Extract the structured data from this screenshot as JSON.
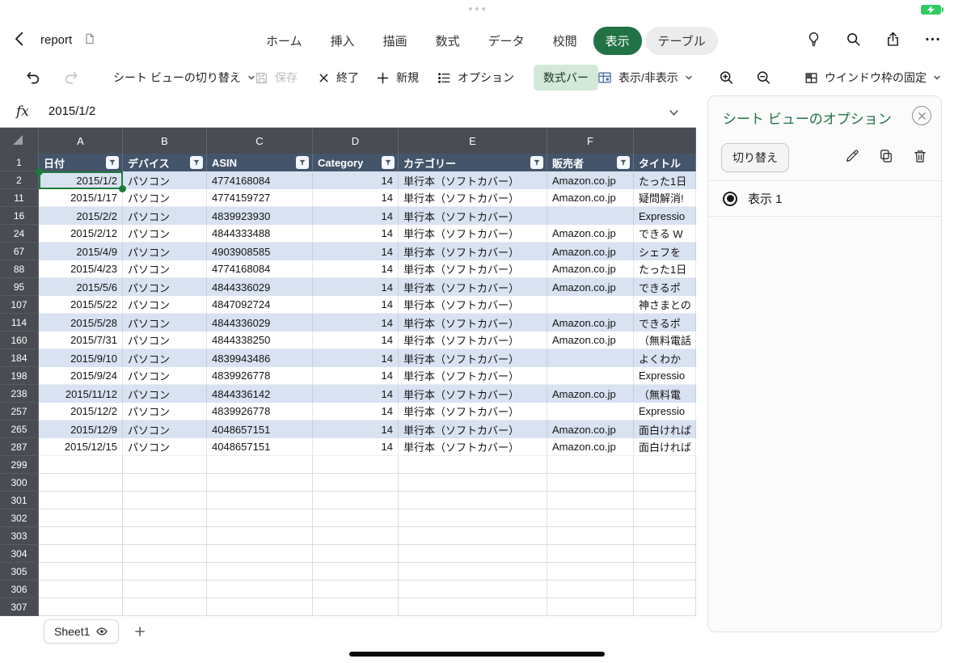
{
  "titlebar": {
    "doc_title": "report",
    "tabs": [
      {
        "label": "ホーム"
      },
      {
        "label": "挿入"
      },
      {
        "label": "描画"
      },
      {
        "label": "数式"
      },
      {
        "label": "データ"
      },
      {
        "label": "校閲"
      },
      {
        "label": "表示",
        "selected": true
      },
      {
        "label": "テーブル",
        "contextual": true
      }
    ]
  },
  "toolbar": {
    "sheet_view_switch": "シート ビューの切り替え",
    "save": "保存",
    "exit": "終了",
    "new": "新規",
    "options": "オプション",
    "formula_bar_toggle": "数式バー",
    "show_hide": "表示/非表示",
    "freeze": "ウインドウ枠の固定"
  },
  "formula_bar": {
    "fx": "fx",
    "value": "2015/1/2"
  },
  "grid": {
    "columns": [
      {
        "letter": "A",
        "width": 104,
        "align": "right"
      },
      {
        "letter": "B",
        "width": 104,
        "align": "left"
      },
      {
        "letter": "C",
        "width": 131,
        "align": "left"
      },
      {
        "letter": "D",
        "width": 106,
        "align": "right"
      },
      {
        "letter": "E",
        "width": 184,
        "align": "left"
      },
      {
        "letter": "F",
        "width": 107,
        "align": "left"
      },
      {
        "letter": "",
        "width": 77,
        "align": "left"
      }
    ],
    "header_row_num": "1",
    "headers": [
      {
        "label": "日付",
        "filter": true
      },
      {
        "label": "デバイス",
        "filter": true
      },
      {
        "label": "ASIN",
        "filter": true
      },
      {
        "label": "Category",
        "filter": true
      },
      {
        "label": "カテゴリー",
        "filter": true
      },
      {
        "label": "販売者",
        "filter": true
      },
      {
        "label": "タイトル",
        "filter": false
      }
    ],
    "rows": [
      {
        "num": 2,
        "band": true,
        "cells": [
          "2015/1/2",
          "パソコン",
          "4774168084",
          "14",
          "単行本（ソフトカバー）",
          "Amazon.co.jp",
          "たった1日"
        ]
      },
      {
        "num": 11,
        "band": false,
        "cells": [
          "2015/1/17",
          "パソコン",
          "4774159727",
          "14",
          "単行本（ソフトカバー）",
          "Amazon.co.jp",
          "疑問解消!"
        ]
      },
      {
        "num": 16,
        "band": true,
        "cells": [
          "2015/2/2",
          "パソコン",
          "4839923930",
          "14",
          "単行本（ソフトカバー）",
          "",
          "Expressio"
        ]
      },
      {
        "num": 24,
        "band": false,
        "cells": [
          "2015/2/12",
          "パソコン",
          "4844333488",
          "14",
          "単行本（ソフトカバー）",
          "Amazon.co.jp",
          "できる W"
        ]
      },
      {
        "num": 67,
        "band": true,
        "cells": [
          "2015/4/9",
          "パソコン",
          "4903908585",
          "14",
          "単行本（ソフトカバー）",
          "Amazon.co.jp",
          "シェフを"
        ]
      },
      {
        "num": 88,
        "band": false,
        "cells": [
          "2015/4/23",
          "パソコン",
          "4774168084",
          "14",
          "単行本（ソフトカバー）",
          "Amazon.co.jp",
          "たった1日"
        ]
      },
      {
        "num": 95,
        "band": true,
        "cells": [
          "2015/5/6",
          "パソコン",
          "4844336029",
          "14",
          "単行本（ソフトカバー）",
          "Amazon.co.jp",
          "できるポ"
        ]
      },
      {
        "num": 107,
        "band": false,
        "cells": [
          "2015/5/22",
          "パソコン",
          "4847092724",
          "14",
          "単行本（ソフトカバー）",
          "",
          "神さまとの"
        ]
      },
      {
        "num": 114,
        "band": true,
        "cells": [
          "2015/5/28",
          "パソコン",
          "4844336029",
          "14",
          "単行本（ソフトカバー）",
          "Amazon.co.jp",
          "できるポ"
        ]
      },
      {
        "num": 160,
        "band": false,
        "cells": [
          "2015/7/31",
          "パソコン",
          "4844338250",
          "14",
          "単行本（ソフトカバー）",
          "Amazon.co.jp",
          "（無料電話"
        ]
      },
      {
        "num": 184,
        "band": true,
        "cells": [
          "2015/9/10",
          "パソコン",
          "4839943486",
          "14",
          "単行本（ソフトカバー）",
          "",
          "よくわか"
        ]
      },
      {
        "num": 198,
        "band": false,
        "cells": [
          "2015/9/24",
          "パソコン",
          "4839926778",
          "14",
          "単行本（ソフトカバー）",
          "",
          "Expressio"
        ]
      },
      {
        "num": 238,
        "band": true,
        "cells": [
          "2015/11/12",
          "パソコン",
          "4844336142",
          "14",
          "単行本（ソフトカバー）",
          "Amazon.co.jp",
          "（無料電"
        ]
      },
      {
        "num": 257,
        "band": false,
        "cells": [
          "2015/12/2",
          "パソコン",
          "4839926778",
          "14",
          "単行本（ソフトカバー）",
          "",
          "Expressio"
        ]
      },
      {
        "num": 265,
        "band": true,
        "cells": [
          "2015/12/9",
          "パソコン",
          "4048657151",
          "14",
          "単行本（ソフトカバー）",
          "Amazon.co.jp",
          "面白ければ"
        ]
      },
      {
        "num": 287,
        "band": false,
        "cells": [
          "2015/12/15",
          "パソコン",
          "4048657151",
          "14",
          "単行本（ソフトカバー）",
          "Amazon.co.jp",
          "面白ければ"
        ]
      }
    ],
    "empty_row_nums": [
      299,
      300,
      301,
      302,
      303,
      304,
      305,
      306,
      307
    ],
    "selection": {
      "cell": "A2",
      "value": "2015/1/2"
    }
  },
  "sheetbar": {
    "sheet_name": "Sheet1"
  },
  "panel": {
    "title": "シート ビューのオプション",
    "switch_button": "切り替え",
    "views": [
      {
        "label": "表示 1",
        "selected": true
      }
    ]
  },
  "colors": {
    "accent_green": "#217346",
    "table_header": "#44546a",
    "band_blue": "#d9e2f1",
    "header_strip": "#494c52"
  }
}
